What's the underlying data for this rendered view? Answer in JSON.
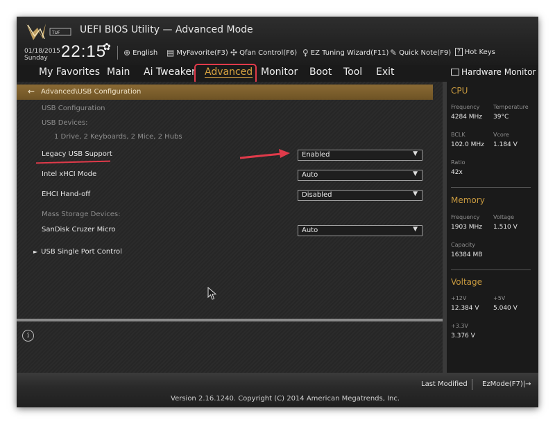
{
  "header": {
    "title": "UEFI BIOS Utility — Advanced Mode",
    "date": "01/18/2015",
    "day": "Sunday",
    "time": "22:15",
    "toolbar": [
      {
        "label": "English",
        "icon": "globe-icon"
      },
      {
        "label": "MyFavorite(F3)",
        "icon": "favorite-icon"
      },
      {
        "label": "Qfan Control(F6)",
        "icon": "fan-icon"
      },
      {
        "label": "EZ Tuning Wizard(F11)",
        "icon": "lightbulb-icon"
      },
      {
        "label": "Quick Note(F9)",
        "icon": "note-icon"
      },
      {
        "label": "Hot Keys",
        "icon": "help-icon"
      }
    ]
  },
  "menu": {
    "items": [
      "My Favorites",
      "Main",
      "Ai Tweaker",
      "Advanced",
      "Monitor",
      "Boot",
      "Tool",
      "Exit"
    ],
    "active": "Advanced"
  },
  "breadcrumb": "Advanced\\USB Configuration",
  "content": {
    "usb_configuration": "USB Configuration",
    "usb_devices_label": "USB Devices:",
    "usb_devices_value": "1 Drive, 2 Keyboards, 2 Mice, 2 Hubs",
    "legacy_usb_label": "Legacy USB Support",
    "legacy_usb_value": "Enabled",
    "xhci_label": "Intel xHCI Mode",
    "xhci_value": "Auto",
    "ehci_label": "EHCI Hand-off",
    "ehci_value": "Disabled",
    "mass_storage_label": "Mass Storage Devices:",
    "sandisk_label": "SanDisk Cruzer Micro",
    "sandisk_value": "Auto",
    "single_port_label": "USB Single Port Control"
  },
  "hardware_monitor": {
    "title": "Hardware Monitor",
    "cpu": {
      "title": "CPU",
      "frequency_label": "Frequency",
      "frequency_value": "4284 MHz",
      "temperature_label": "Temperature",
      "temperature_value": "39°C",
      "bclk_label": "BCLK",
      "bclk_value": "102.0 MHz",
      "vcore_label": "Vcore",
      "vcore_value": "1.184 V",
      "ratio_label": "Ratio",
      "ratio_value": "42x"
    },
    "memory": {
      "title": "Memory",
      "frequency_label": "Frequency",
      "frequency_value": "1903 MHz",
      "voltage_label": "Voltage",
      "voltage_value": "1.510 V",
      "capacity_label": "Capacity",
      "capacity_value": "16384 MB"
    },
    "voltage": {
      "title": "Voltage",
      "v12_label": "+12V",
      "v12_value": "12.384 V",
      "v5_label": "+5V",
      "v5_value": "5.040 V",
      "v33_label": "+3.3V",
      "v33_value": "3.376 V"
    }
  },
  "footer": {
    "last_modified": "Last Modified",
    "ez_mode": "EzMode(F7)|→",
    "version": "Version 2.16.1240. Copyright (C) 2014 American Megatrends, Inc."
  },
  "colors": {
    "accent": "#c99a3f",
    "highlight": "#e03a4a",
    "breadcrumb_bg": "#7a5d2c"
  }
}
